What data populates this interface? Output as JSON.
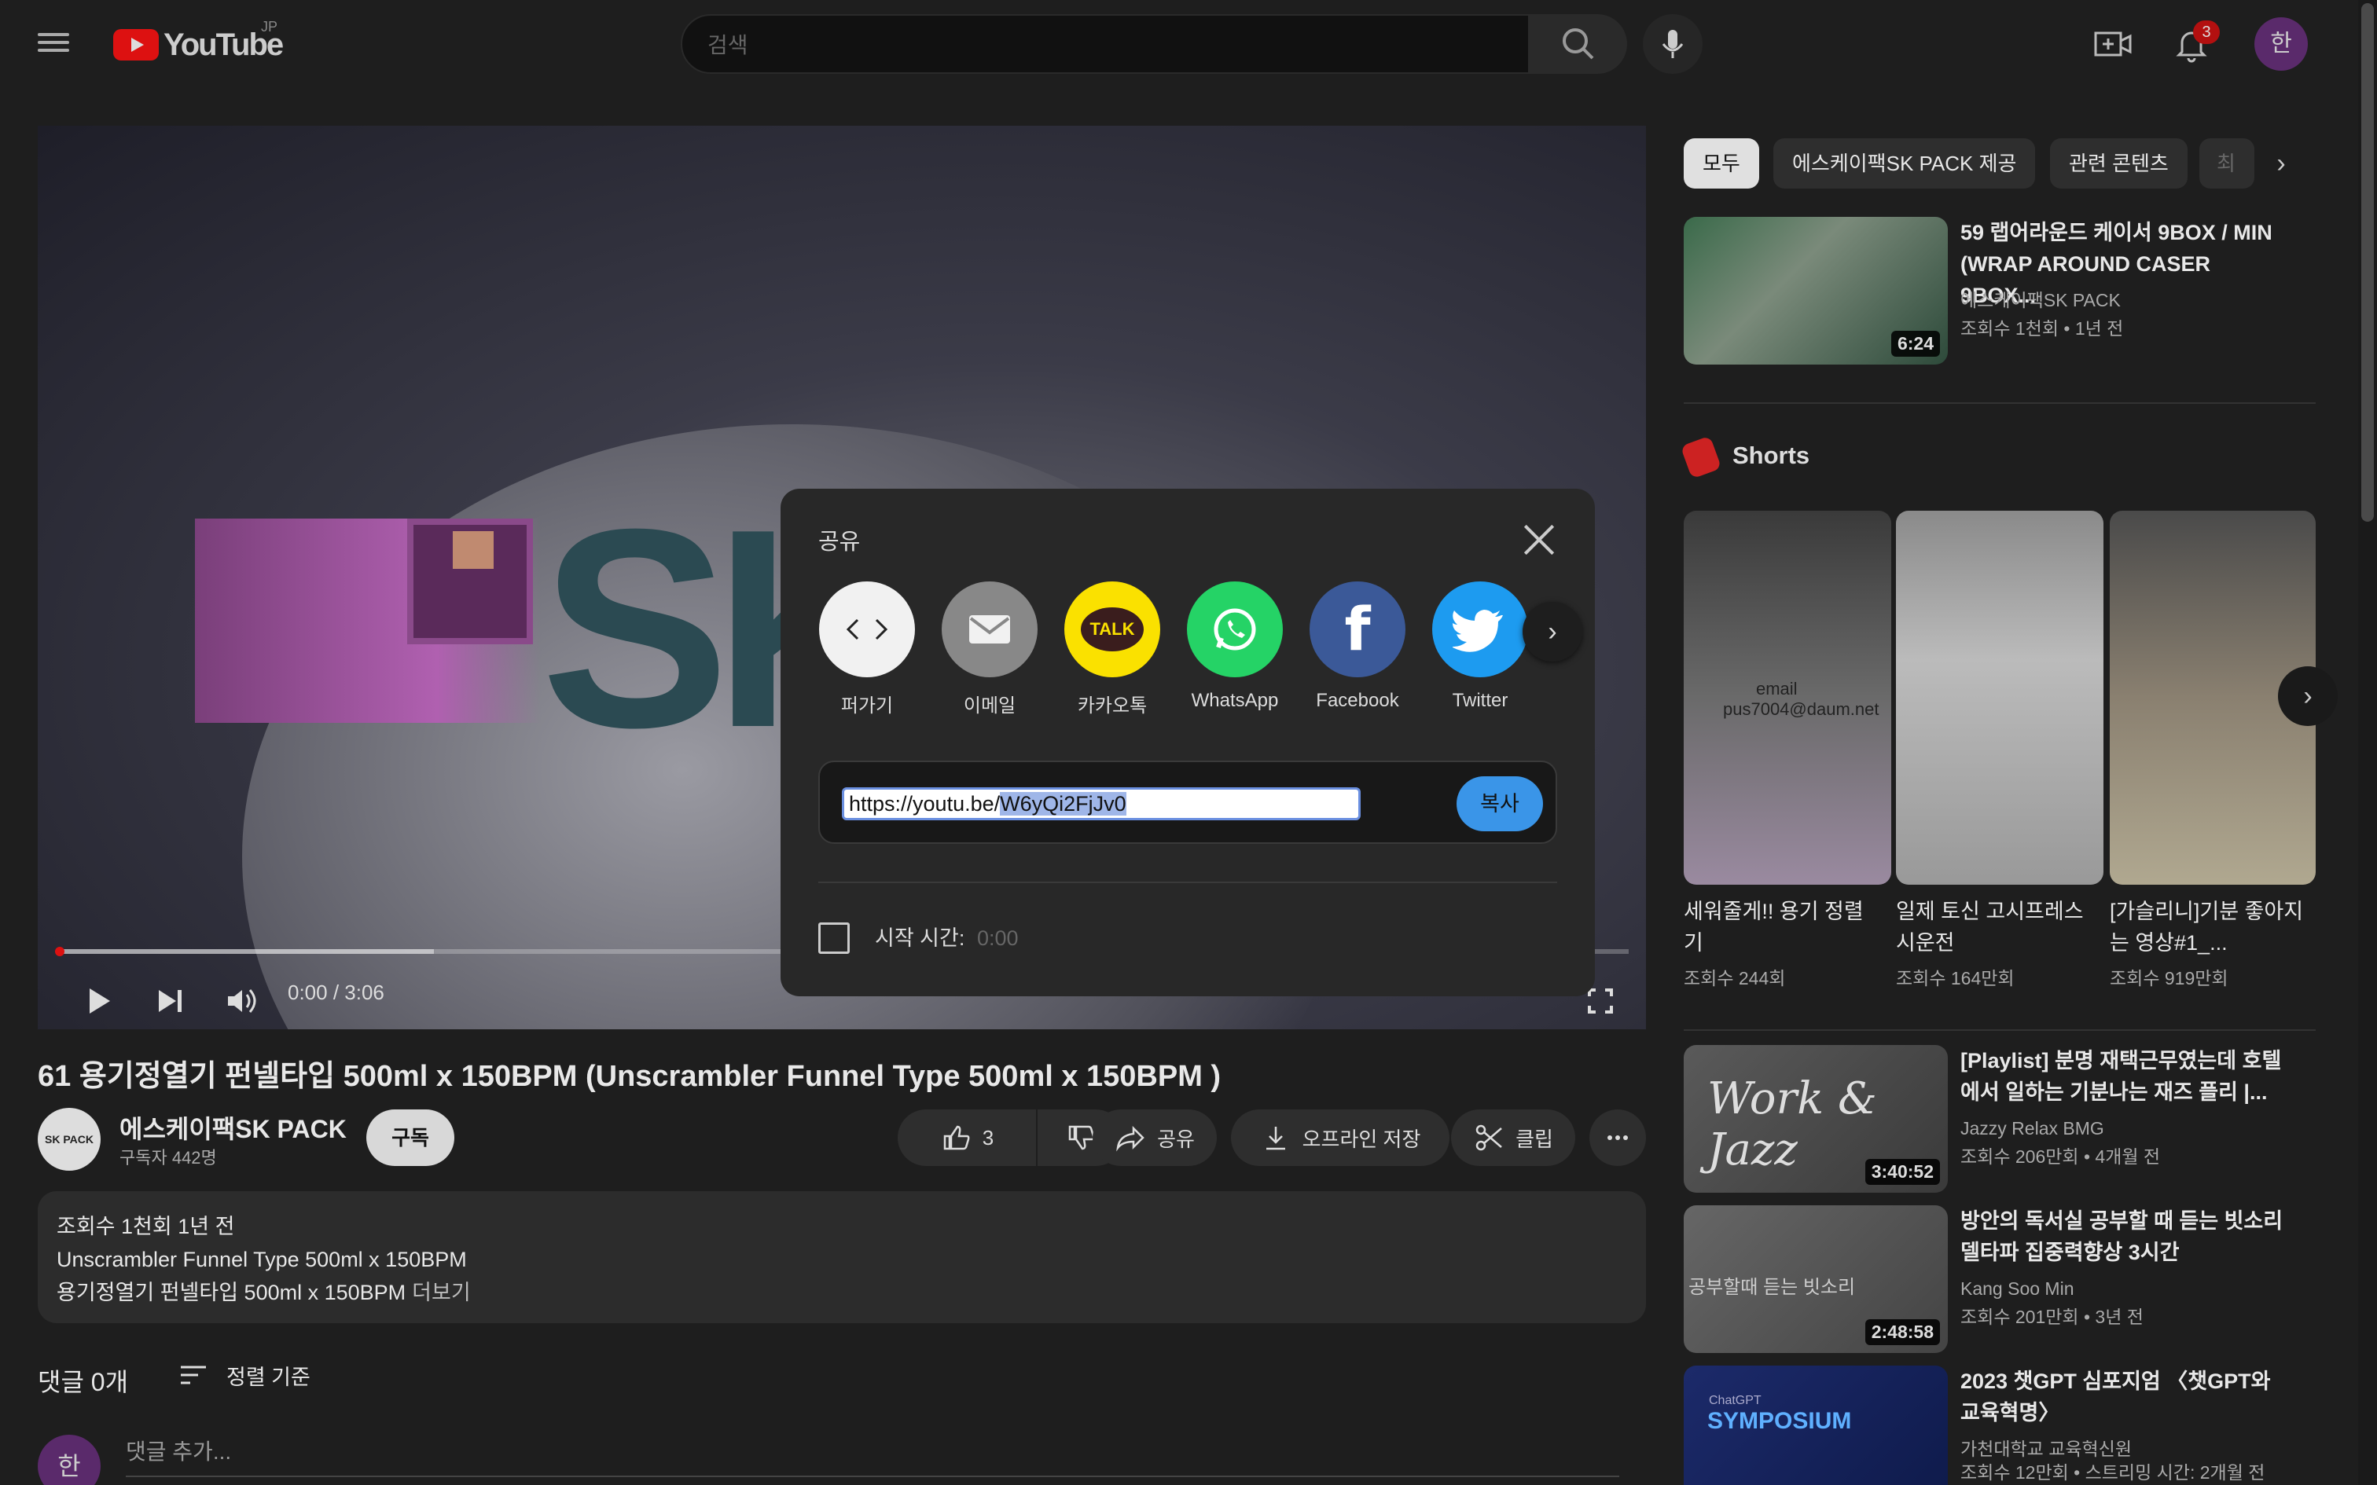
{
  "header": {
    "logo_text": "YouTube",
    "region": "JP",
    "search_placeholder": "검색",
    "notifications": "3",
    "avatar": "한"
  },
  "player": {
    "time": "0:00 / 3:06",
    "progress": 0.0
  },
  "video": {
    "title": "61 용기정열기 펀넬타입 500ml x 150BPM (Unscrambler Funnel Type 500ml x 150BPM )",
    "channel_logo": "SK PACK",
    "channel": "에스케이팩SK PACK",
    "subscribers": "구독자 442명",
    "subscribe": "구독",
    "likes": "3",
    "share": "공유",
    "offline": "오프라인 저장",
    "clip": "클립",
    "desc_line1": "조회수 1천회  1년 전",
    "desc_line2": "Unscrambler Funnel Type 500ml x 150BPM",
    "desc_line3": "용기정열기 펀넬타입 500ml x 150BPM",
    "more": "더보기"
  },
  "comments": {
    "count": "댓글 0개",
    "sort": "정렬 기준",
    "avatar": "한",
    "placeholder": "댓글 추가..."
  },
  "chips": [
    "모두",
    "에스케이팩SK PACK 제공",
    "관련 콘텐츠",
    "최"
  ],
  "related_top": {
    "title": "59 랩어라운드 케이서 9BOX / MIN (WRAP AROUND CASER 9BOX...",
    "channel": "에스케이팩SK PACK",
    "meta": "조회수 1천회 • 1년 전",
    "duration": "6:24"
  },
  "shorts": {
    "label": "Shorts",
    "items": [
      {
        "title": "세워줄게!! 용기 정렬기",
        "views": "조회수 244회",
        "overlay1": "email",
        "overlay2": "pus7004@daum.net"
      },
      {
        "title": "일제 토신 고시프레스 시운전",
        "views": "조회수 164만회"
      },
      {
        "title": "[가슬리니]기분 좋아지는 영상#1_...",
        "views": "조회수 919만회"
      }
    ]
  },
  "related": [
    {
      "title": "[Playlist] 분명 재택근무였는데 호텔에서 일하는 기분나는 재즈 플리 |...",
      "channel": "Jazzy Relax BMG",
      "meta": "조회수 206만회 • 4개월 전",
      "duration": "3:40:52",
      "thumb_text": "Work & Jazz"
    },
    {
      "title": "방안의 독서실 공부할 때 듣는 빗소리 델타파 집중력향상 3시간",
      "channel": "Kang Soo Min",
      "meta": "조회수 201만회 • 3년 전",
      "duration": "2:48:58",
      "thumb_text": "공부할때 듣는 빗소리"
    },
    {
      "title": "2023 챗GPT 심포지엄 〈챗GPT와 교육혁명〉",
      "channel": "가천대학교 교육혁신원",
      "meta": "조회수 12만회 • 스트리밍 시간: 2개월 전",
      "thumb_text": "SYMPOSIUM",
      "thumb_sub": "ChatGPT"
    }
  ],
  "share_dialog": {
    "title": "공유",
    "options": [
      {
        "label": "퍼가기",
        "icon": "embed-icon",
        "color": "#f1f1f1"
      },
      {
        "label": "이메일",
        "icon": "email-icon",
        "color": "#888888"
      },
      {
        "label": "카카오톡",
        "icon": "kakaotalk-icon",
        "color": "#fae100",
        "badge": "TALK"
      },
      {
        "label": "WhatsApp",
        "icon": "whatsapp-icon",
        "color": "#25d366"
      },
      {
        "label": "Facebook",
        "icon": "facebook-icon",
        "color": "#3b5998",
        "badge": "f"
      },
      {
        "label": "Twitter",
        "icon": "twitter-icon",
        "color": "#1d9bf0"
      }
    ],
    "url_prefix": "https://youtu.be/",
    "url_selected": "W6yQi2FjJv0",
    "copy": "복사",
    "start_label": "시작 시간:",
    "start_value": "0:00"
  }
}
